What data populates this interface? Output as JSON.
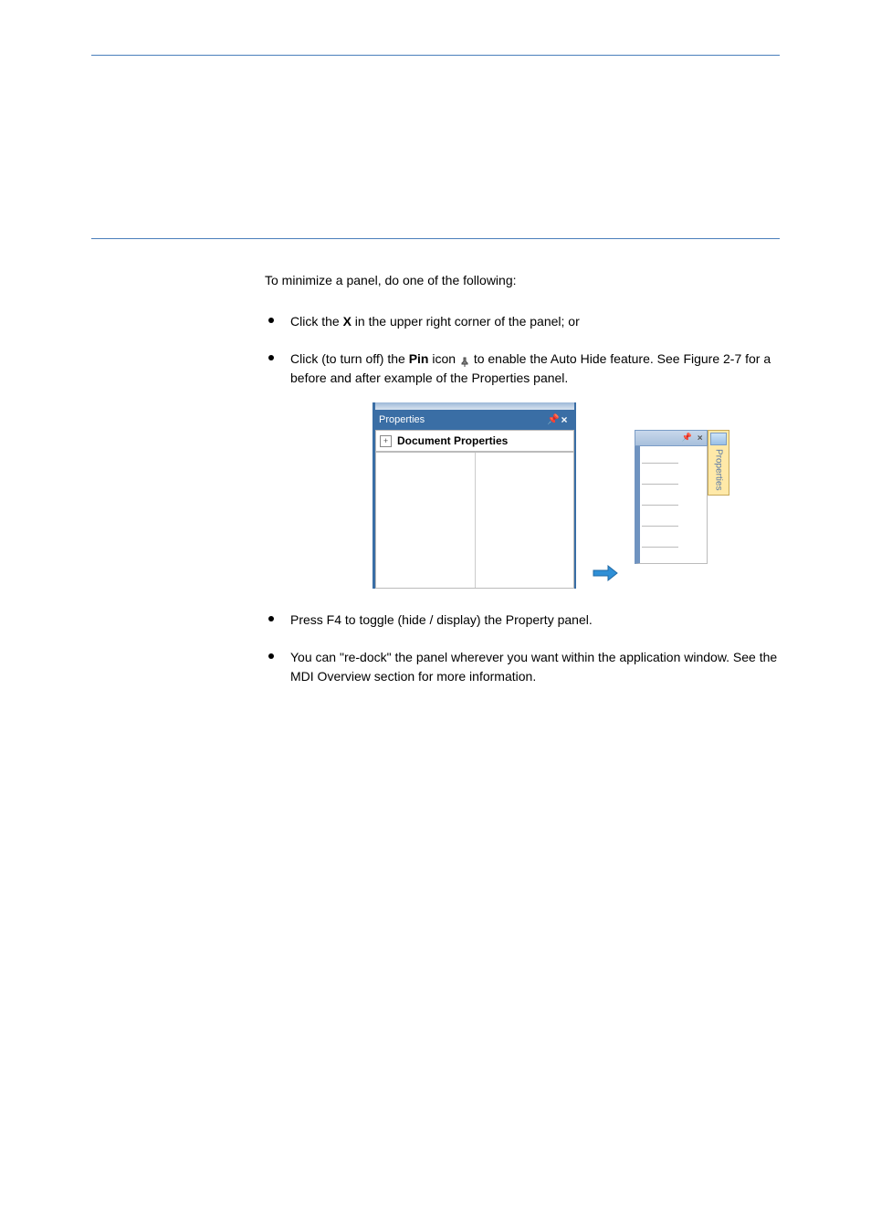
{
  "bullets": {
    "b1_prefix": "Click the ",
    "b1_action": "X",
    "b1_suffix": " in the upper right corner of the panel; or",
    "b2_prefix": "Click (to turn off) the ",
    "b2_icon": "Pin",
    "b2_mid": " icon ",
    "b2_suffix": " to enable the Auto Hide feature. See Figure 2-7 for a before and after example of the Properties panel.",
    "b3": "Press F4 to toggle (hide / display) the Property panel.",
    "b4_prefix": "You can \"re-dock\" the panel wherever you want within the application window. See the ",
    "b4_link": "MDI Overview",
    "b4_suffix": " section for more information.",
    "para": "To minimize a panel, do one of the following:"
  },
  "panel1": {
    "title": "Properties",
    "doc_props": "Document Properties"
  },
  "panel2": {
    "tab": "Properties"
  }
}
